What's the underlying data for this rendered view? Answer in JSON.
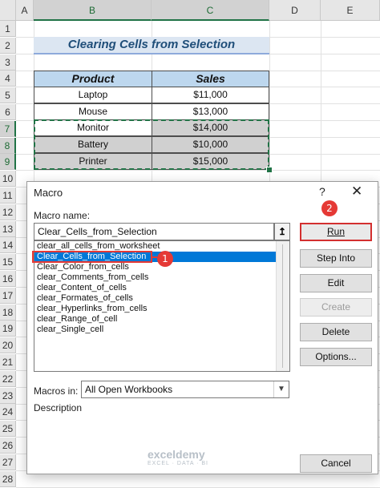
{
  "sheet": {
    "columns": [
      "A",
      "B",
      "C",
      "D",
      "E"
    ],
    "rows": [
      "1",
      "2",
      "3",
      "4",
      "5",
      "6",
      "7",
      "8",
      "9",
      "10",
      "11",
      "12",
      "13",
      "14",
      "15",
      "16",
      "17",
      "18",
      "19",
      "20",
      "21",
      "22",
      "23",
      "24",
      "25",
      "26",
      "27",
      "28"
    ],
    "title": "Clearing Cells from Selection",
    "table": {
      "headers": [
        "Product",
        "Sales"
      ],
      "rows": [
        [
          "Laptop",
          "$11,000"
        ],
        [
          "Mouse",
          "$13,000"
        ],
        [
          "Monitor",
          "$14,000"
        ],
        [
          "Battery",
          "$10,000"
        ],
        [
          "Printer",
          "$15,000"
        ]
      ]
    }
  },
  "dialog": {
    "title": "Macro",
    "help": "?",
    "close": "✕",
    "macro_name_label": "Macro name:",
    "macro_name_value": "Clear_Cells_from_Selection",
    "upload_icon": "↥",
    "macros": [
      "clear_all_cells_from_worksheet",
      "Clear_Cells_from_Selection",
      "Clear_Color_from_cells",
      "clear_Comments_from_cells",
      "clear_Content_of_cells",
      "clear_Formates_of_cells",
      "clear_Hyperlinks_from_cells",
      "clear_Range_of_cell",
      "clear_Single_cell"
    ],
    "selected_index": 1,
    "buttons": {
      "run": "Run",
      "step_into": "Step Into",
      "edit": "Edit",
      "create": "Create",
      "delete": "Delete",
      "options": "Options...",
      "cancel": "Cancel"
    },
    "macros_in_label": "Macros in:",
    "macros_in_value": "All Open Workbooks",
    "description_label": "Description",
    "watermark": "exceldemy",
    "watermark_sub": "EXCEL · DATA · BI"
  },
  "annotations": {
    "step1": "1",
    "step2": "2"
  },
  "colors": {
    "accent_red": "#e53935",
    "excel_green": "#217346",
    "selection_blue": "#0078d7"
  }
}
